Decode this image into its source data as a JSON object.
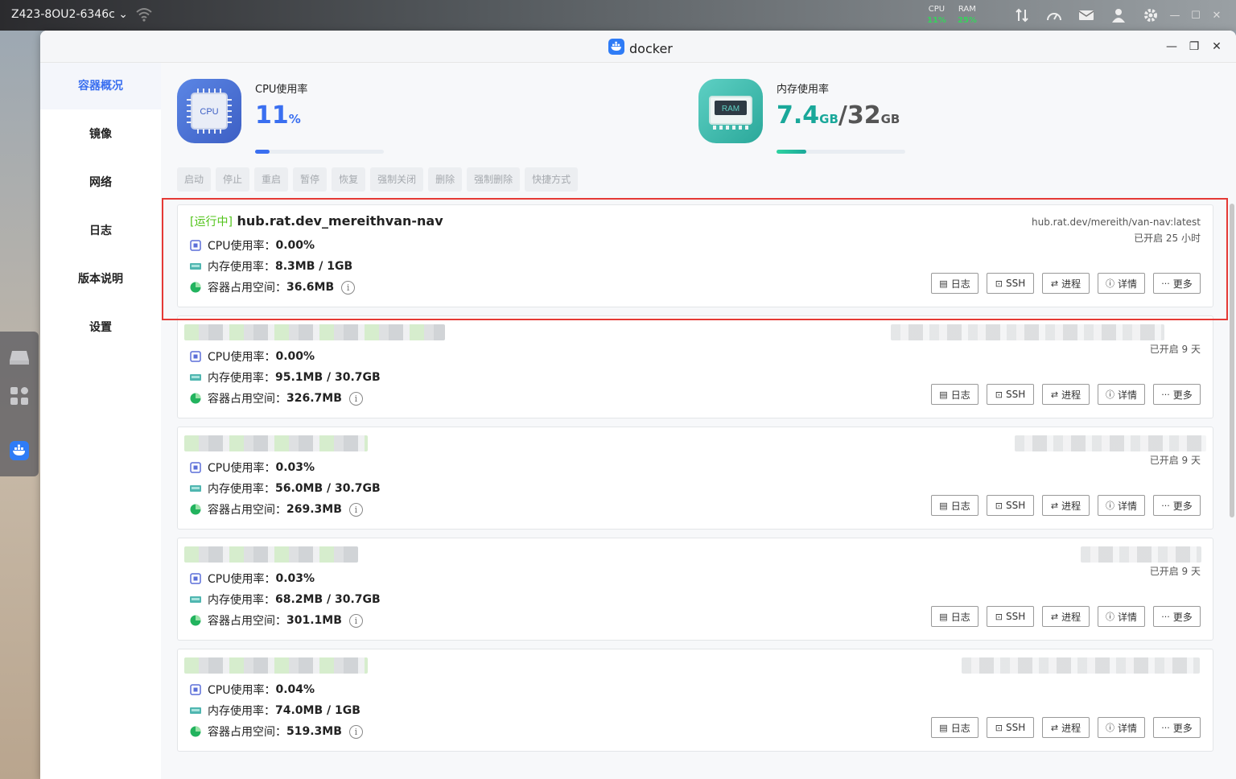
{
  "system_bar": {
    "device_name": "Z423-8OU2-6346c",
    "cpu_label": "CPU",
    "cpu_value": "11%",
    "ram_label": "RAM",
    "ram_value": "25%"
  },
  "window": {
    "app_title": "docker"
  },
  "sidebar": {
    "items": [
      {
        "label": "容器概况",
        "active": true
      },
      {
        "label": "镜像",
        "active": false
      },
      {
        "label": "网络",
        "active": false
      },
      {
        "label": "日志",
        "active": false
      },
      {
        "label": "版本说明",
        "active": false
      },
      {
        "label": "设置",
        "active": false
      }
    ]
  },
  "stats": {
    "cpu": {
      "label": "CPU使用率",
      "value": "11",
      "unit": "%",
      "icon_text": "CPU",
      "fraction": 0.11,
      "color": "#3a6ff0"
    },
    "mem": {
      "label": "内存使用率",
      "used": "7.4",
      "used_unit": "GB",
      "sep": "/",
      "total": "32",
      "total_unit": "GB",
      "icon_text": "RAM",
      "fraction": 0.23,
      "color": "#1aa89a"
    }
  },
  "toolbar": {
    "buttons": [
      "启动",
      "停止",
      "重启",
      "暂停",
      "恢复",
      "强制关闭",
      "删除",
      "强制删除",
      "快捷方式"
    ]
  },
  "labels": {
    "cpu": "CPU使用率：",
    "mem": "内存使用率：",
    "disk": "容器占用空间：",
    "info_symbol": "i"
  },
  "actions": {
    "log": "日志",
    "ssh": "SSH",
    "process": "进程",
    "detail": "详情",
    "more": "更多"
  },
  "containers": [
    {
      "status": "[运行中]",
      "name": "hub.rat.dev_mereithvan-nav",
      "image": "hub.rat.dev/mereith/van-nav:latest",
      "uptime": "已开启 25 小时",
      "cpu": "0.00%",
      "mem": "8.3MB / 1GB",
      "disk": "36.6MB"
    },
    {
      "status": "",
      "name": "",
      "image": "",
      "uptime": "已开启 9 天",
      "cpu": "0.00%",
      "mem": "95.1MB / 30.7GB",
      "disk": "326.7MB"
    },
    {
      "status": "",
      "name": "",
      "image": "",
      "uptime": "已开启 9 天",
      "cpu": "0.03%",
      "mem": "56.0MB / 30.7GB",
      "disk": "269.3MB"
    },
    {
      "status": "",
      "name": "",
      "image": "",
      "uptime": "已开启 9 天",
      "cpu": "0.03%",
      "mem": "68.2MB / 30.7GB",
      "disk": "301.1MB"
    },
    {
      "status": "",
      "name": "",
      "image": "",
      "uptime": "",
      "cpu": "0.04%",
      "mem": "74.0MB / 1GB",
      "disk": "519.3MB"
    }
  ]
}
